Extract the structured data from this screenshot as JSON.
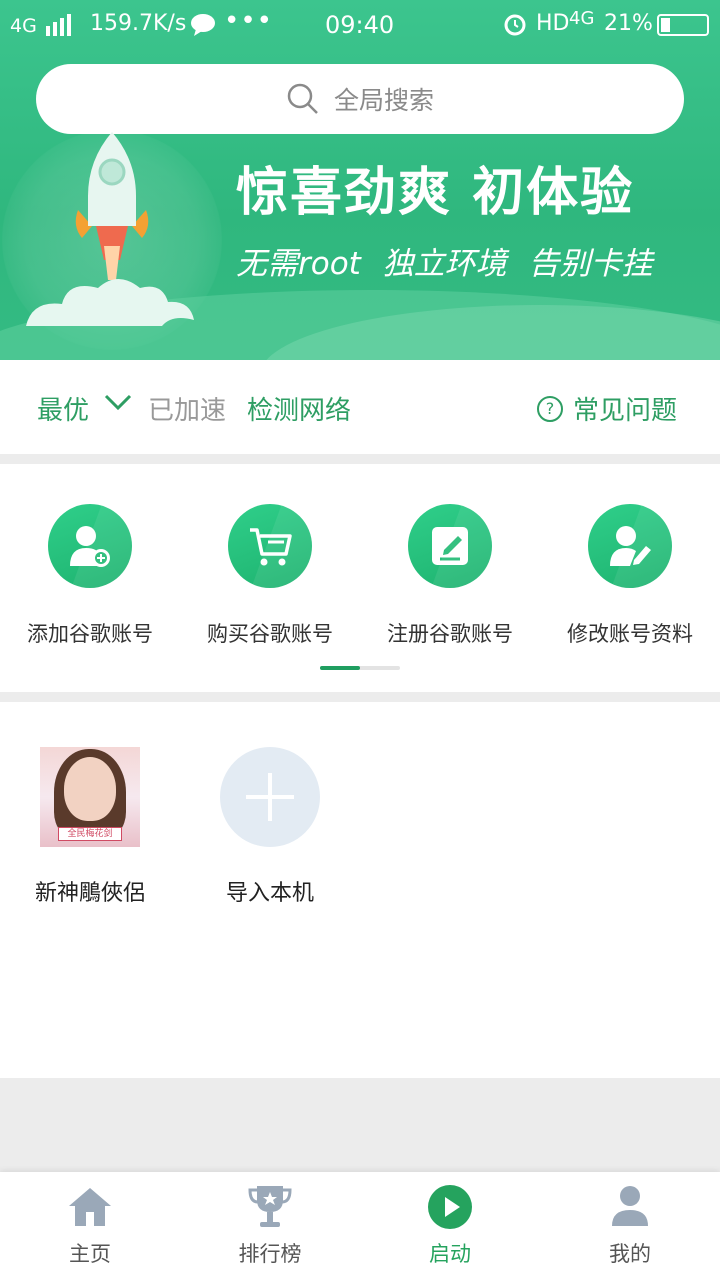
{
  "status_bar": {
    "network": "4G",
    "speed": "159.7K/s",
    "more": "•••",
    "time": "09:40",
    "hd": "HD",
    "network_right": "4G",
    "battery": "21%"
  },
  "search": {
    "placeholder": "全局搜索"
  },
  "banner": {
    "headline": "惊喜劲爽  初体验",
    "subline": "无需root 独立环境 告别卡挂"
  },
  "accelerate": {
    "mode": "最优",
    "state": "已加速",
    "check_network": "检测网络",
    "faq": "常见问题",
    "faq_icon": "?"
  },
  "shortcuts": [
    {
      "label": "添加谷歌账号",
      "icon": "add-user-icon"
    },
    {
      "label": "购买谷歌账号",
      "icon": "cart-icon"
    },
    {
      "label": "注册谷歌账号",
      "icon": "edit-icon"
    },
    {
      "label": "修改账号资料",
      "icon": "user-edit-icon"
    }
  ],
  "apps": [
    {
      "name": "新神鵰俠侶",
      "icon": "game-icon",
      "badge": "全民梅花剑"
    },
    {
      "name": "导入本机",
      "icon": "plus-icon"
    }
  ],
  "tabs": [
    {
      "label": "主页",
      "icon": "home-icon"
    },
    {
      "label": "排行榜",
      "icon": "trophy-icon"
    },
    {
      "label": "启动",
      "icon": "play-icon",
      "active": true
    },
    {
      "label": "我的",
      "icon": "user-icon"
    }
  ],
  "colors": {
    "brand_green": "#2fb77e",
    "accent_text": "#2e9e63",
    "active_tab": "#25a35e"
  }
}
